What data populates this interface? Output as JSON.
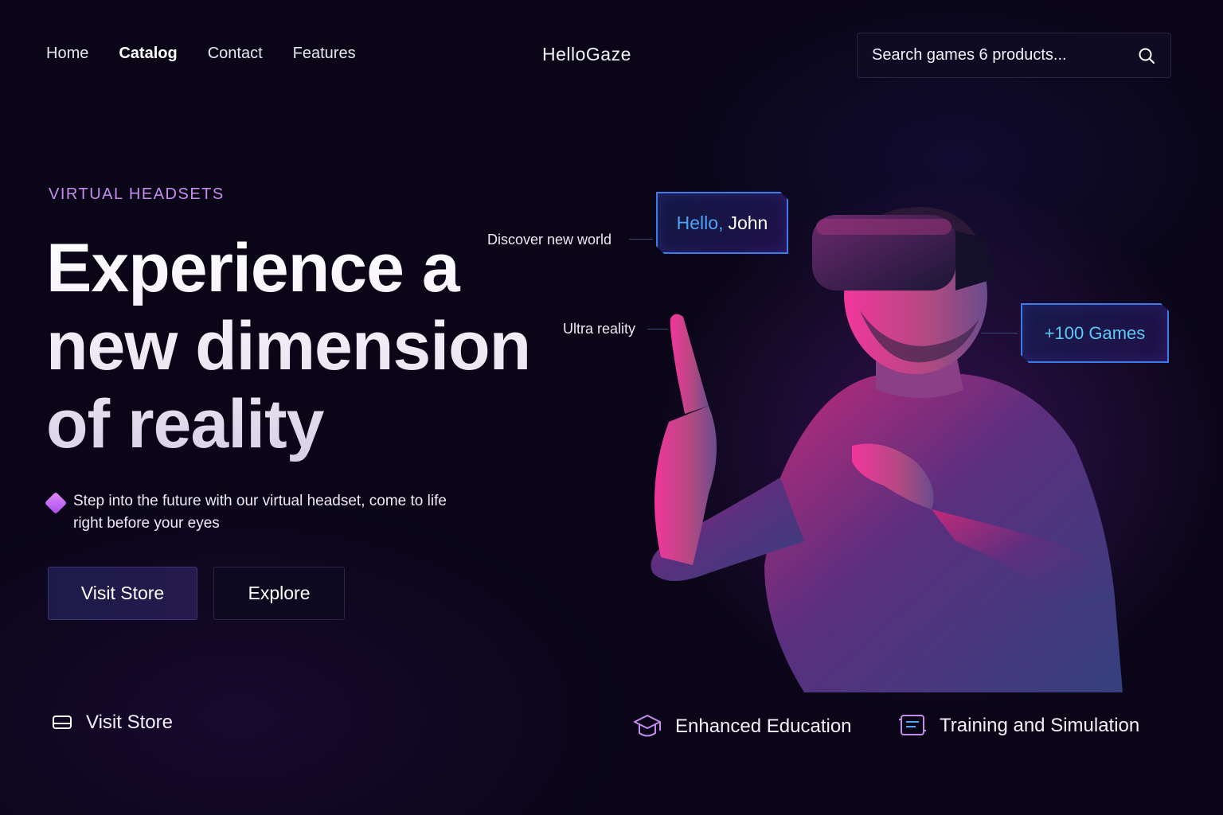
{
  "nav": {
    "links": [
      "Home",
      "Catalog",
      "Contact",
      "Features"
    ],
    "active_index": 1,
    "brand": "HelloGaze",
    "search_placeholder": "Search games 6 products..."
  },
  "hero": {
    "eyebrow": "VIRTUAL HEADSETS",
    "headline": [
      "Experience a",
      "new dimension",
      "of reality"
    ],
    "description": "Step into the future with our virtual headset, come to life right before your eyes",
    "primary_button": "Visit Store",
    "secondary_button": "Explore"
  },
  "overlay": {
    "callout_discover": "Discover new world",
    "callout_ultra": "Ultra reality",
    "hello_prefix": "Hello,",
    "hello_name": "John",
    "games_badge": "+100 Games"
  },
  "features": {
    "store": "Visit Store",
    "education": "Enhanced Education",
    "training": "Training and Simulation"
  },
  "colors": {
    "background": "#0a0618",
    "accent_purple": "#c78bf0",
    "hud_blue": "#3b7ce8",
    "magenta_light": "#ff2fa0"
  },
  "icons": {
    "search": "search-icon",
    "bullet": "diamond-icon",
    "store": "headset-icon",
    "education": "graduation-cap-icon",
    "training": "simulation-board-icon"
  }
}
